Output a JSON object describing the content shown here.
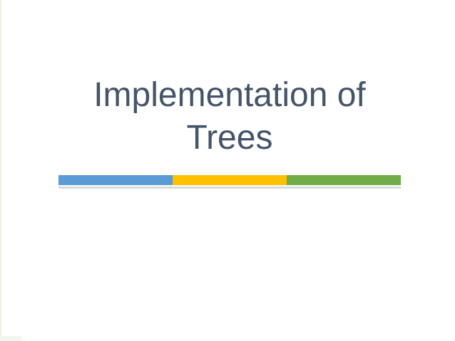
{
  "slide": {
    "title_line_1": "Implementation of",
    "title_line_2": "Trees"
  },
  "colors": {
    "title_text": "#445469",
    "bar_blue": "#5b9bd5",
    "bar_yellow": "#ffc000",
    "bar_green": "#70ad47",
    "underline": "#d9d9d9"
  }
}
